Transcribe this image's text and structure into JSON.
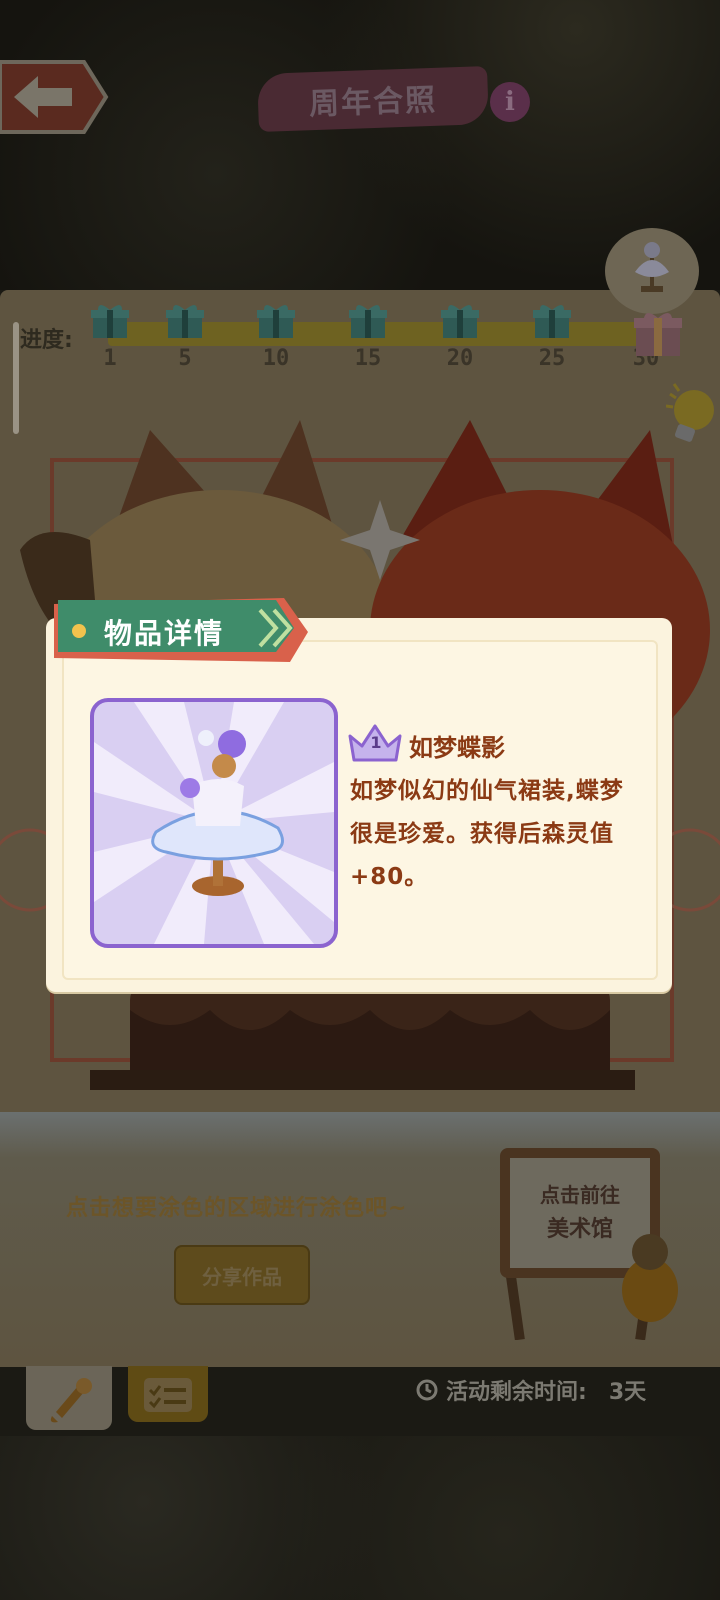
{
  "header": {
    "title": "周年合照"
  },
  "progress": {
    "label": "进度:",
    "milestones": [
      "1",
      "5",
      "10",
      "15",
      "20",
      "25",
      "30"
    ]
  },
  "canvas": {
    "hint": "点击想要涂色的区域进行涂色吧~",
    "share_label": "分享作品",
    "museum_sign": [
      "点击前往",
      "美术馆"
    ]
  },
  "footer": {
    "timer_label": "活动剩余时间:",
    "timer_value": "3天"
  },
  "modal": {
    "title": "物品详情",
    "item": {
      "rank": "1",
      "name": "如梦蝶影",
      "description": "如梦似幻的仙气裙装,蝶梦很是珍爱。获得后森灵值+80。"
    }
  },
  "colors": {
    "accent_purple": "#8b63cf",
    "title_brown": "#8b3a14",
    "header_red": "#d9614b",
    "header_green": "#3f8c6a",
    "panel_cream": "#fbf3de"
  }
}
